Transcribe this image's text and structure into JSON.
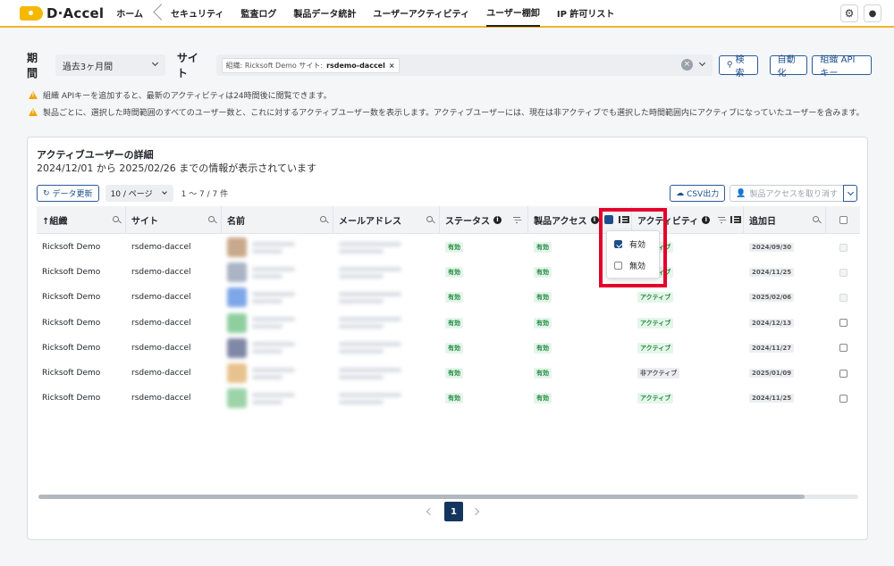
{
  "nav": {
    "logo": "D·Accel",
    "items": [
      "ホーム",
      "セキュリティ",
      "監査ログ",
      "製品データ統計",
      "ユーザーアクティビティ",
      "ユーザー棚卸",
      "IP 許可リスト"
    ]
  },
  "filters": {
    "period_label": "期間",
    "period_value": "過去3ヶ月間",
    "site_label": "サイト",
    "site_tag_prefix": "組織: Ricksoft Demo サイト:",
    "site_tag_value": "rsdemo-daccel",
    "search_button": "検索",
    "automation_button": "自動化",
    "org_api_button": "組織 APIキー"
  },
  "notices": [
    "組織 APIキーを追加すると、最新のアクティビティは24時間後に閲覧できます。",
    "製品ごとに、選択した時間範囲のすべてのユーザー数と、これに対するアクティブユーザー数を表示します。アクティブユーザーには、現在は非アクティブでも選択した時間範囲内にアクティブになっていたユーザーを含みます。"
  ],
  "card": {
    "title": "アクティブユーザーの詳細",
    "subtitle": "2024/12/01 から 2025/02/26 までの情報が表示されています",
    "refresh_button": "データ更新",
    "per_page": "10 / ページ",
    "range_text": "1 〜 7 / 7 件",
    "csv_button": "CSV出力",
    "revoke_button": "製品アクセスを取り消す"
  },
  "table": {
    "headers": [
      "↑組織",
      "サイト",
      "名前",
      "メールアドレス",
      "ステータス",
      "製品アクセス",
      "アクティビティ",
      "追加日"
    ],
    "rows": [
      {
        "org": "Ricksoft Demo",
        "site": "rsdemo-daccel",
        "status": "有効",
        "access": "有効",
        "activity": "アクティブ",
        "added": "2024/09/30"
      },
      {
        "org": "Ricksoft Demo",
        "site": "rsdemo-daccel",
        "status": "有効",
        "access": "有効",
        "activity": "アクティブ",
        "added": "2024/11/25"
      },
      {
        "org": "Ricksoft Demo",
        "site": "rsdemo-daccel",
        "status": "有効",
        "access": "有効",
        "activity": "アクティブ",
        "added": "2025/02/06"
      },
      {
        "org": "Ricksoft Demo",
        "site": "rsdemo-daccel",
        "status": "有効",
        "access": "有効",
        "activity": "アクティブ",
        "added": "2024/12/13"
      },
      {
        "org": "Ricksoft Demo",
        "site": "rsdemo-daccel",
        "status": "有効",
        "access": "有効",
        "activity": "アクティブ",
        "added": "2024/11/27"
      },
      {
        "org": "Ricksoft Demo",
        "site": "rsdemo-daccel",
        "status": "有効",
        "access": "有効",
        "activity": "非アクティブ",
        "added": "2025/01/09"
      },
      {
        "org": "Ricksoft Demo",
        "site": "rsdemo-daccel",
        "status": "有効",
        "access": "有効",
        "activity": "アクティブ",
        "added": "2024/11/25"
      }
    ]
  },
  "dropdown": {
    "options": [
      {
        "label": "有効",
        "checked": true
      },
      {
        "label": "無効",
        "checked": false
      }
    ]
  },
  "pager": {
    "current": "1"
  },
  "colors": {
    "accent": "#f0b429",
    "primary": "#1d4e89",
    "highlight": "#e4002b",
    "badge_green": "#1f8a3f"
  }
}
